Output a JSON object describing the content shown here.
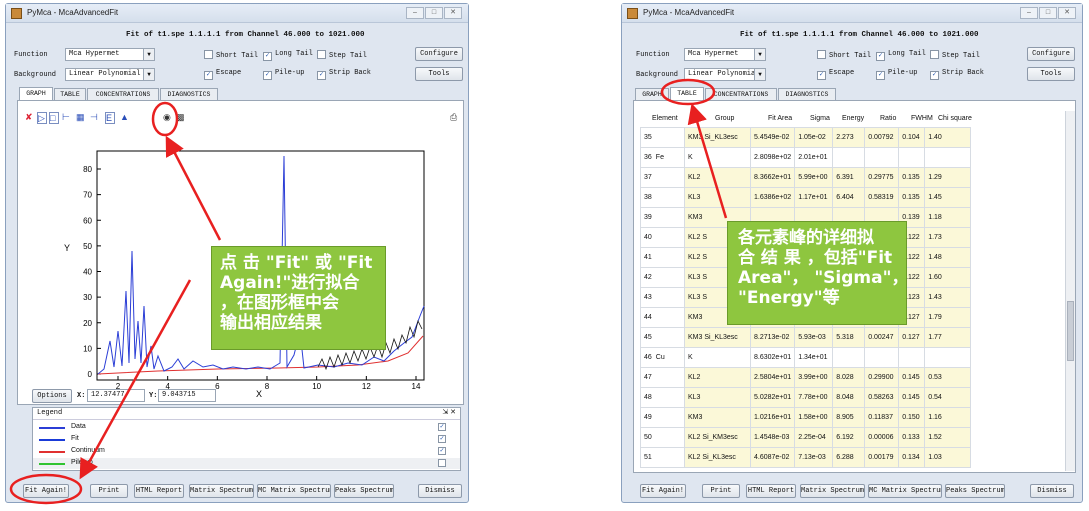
{
  "left_window": {
    "title": "PyMca - McaAdvancedFit",
    "fit_title": "Fit of t1.spe 1.1.1.1 from Channel 46.000 to 1021.000",
    "function_label": "Function",
    "function_value": "Mca Hypermet",
    "background_label": "Background",
    "background_value": "Linear Polynomial",
    "checks": [
      {
        "label": "Short Tail",
        "checked": false
      },
      {
        "label": "Long Tail",
        "checked": true
      },
      {
        "label": "Step Tail",
        "checked": false
      },
      {
        "label": "Escape",
        "checked": true
      },
      {
        "label": "Pile-up",
        "checked": true
      },
      {
        "label": "Strip Back",
        "checked": true
      }
    ],
    "configure_label": "Configure",
    "tools_label": "Tools",
    "tabs": [
      "GRAPH",
      "TABLE",
      "CONCENTRATIONS",
      "DIAGNOSTICS"
    ],
    "plot": {
      "y_label": "Y",
      "x_label": "X",
      "y_ticks": [
        "80",
        "70",
        "60",
        "50",
        "40",
        "30",
        "20",
        "10",
        "0"
      ],
      "x_ticks": [
        "2",
        "4",
        "6",
        "8",
        "10",
        "12",
        "14"
      ]
    },
    "options_label": "Options",
    "x_coord_label": "X:",
    "x_coord_value": "12.37477",
    "y_coord_label": "Y:",
    "y_coord_value": "9.043715",
    "legend_title": "Legend",
    "legend": [
      {
        "name": "Data",
        "color": "#2b3ed6",
        "checked": true
      },
      {
        "name": "Fit",
        "color": "#1a3bd8",
        "checked": true
      },
      {
        "name": "Continuum",
        "color": "#e03030",
        "checked": true
      },
      {
        "name": "Pile-up",
        "color": "#31c431",
        "checked": false
      }
    ],
    "bottom_buttons": [
      "Fit Again!",
      "Print",
      "HTML Report",
      "Matrix Spectrum",
      "MC Matrix Spectrum",
      "Peaks Spectrum",
      "Dismiss"
    ],
    "callout_lines": [
      "点 击 \"Fit\" 或 \"Fit",
      "Again!\"进行拟合",
      "，在图形框中会",
      "输出相应结果"
    ]
  },
  "right_window": {
    "title": "PyMca - McaAdvancedFit",
    "fit_title": "Fit of t1.spe 1.1.1.1 from Channel 46.000 to 1021.000",
    "function_label": "Function",
    "function_value": "Mca Hypermet",
    "background_label": "Background",
    "background_value": "Linear Polynomial",
    "checks": [
      {
        "label": "Short Tail",
        "checked": false
      },
      {
        "label": "Long Tail",
        "checked": true
      },
      {
        "label": "Step Tail",
        "checked": false
      },
      {
        "label": "Escape",
        "checked": true
      },
      {
        "label": "Pile-up",
        "checked": true
      },
      {
        "label": "Strip Back",
        "checked": true
      }
    ],
    "configure_label": "Configure",
    "tools_label": "Tools",
    "tabs": [
      "GRAPH",
      "TABLE",
      "CONCENTRATIONS",
      "DIAGNOSTICS"
    ],
    "table_headers": [
      "Element",
      "Group",
      "Fit Area",
      "Sigma",
      "Energy",
      "Ratio",
      "FWHM",
      "Chi square"
    ],
    "rows": [
      {
        "n": "35",
        "el": "",
        "group": "KM3 Si_KL3esc",
        "area": "5.4549e-02",
        "sigma": "1.05e-02",
        "energy": "2.273",
        "ratio": "0.00792",
        "fwhm": "0.104",
        "chi": "1.40",
        "sh": true
      },
      {
        "n": "36",
        "el": "Fe",
        "group": "K",
        "area": "2.8098e+02",
        "sigma": "2.01e+01",
        "energy": "",
        "ratio": "",
        "fwhm": "",
        "chi": "",
        "sh": false
      },
      {
        "n": "37",
        "el": "",
        "group": "KL2",
        "area": "8.3662e+01",
        "sigma": "5.99e+00",
        "energy": "6.391",
        "ratio": "0.29775",
        "fwhm": "0.135",
        "chi": "1.29",
        "sh": true
      },
      {
        "n": "38",
        "el": "",
        "group": "KL3",
        "area": "1.6386e+02",
        "sigma": "1.17e+01",
        "energy": "6.404",
        "ratio": "0.58319",
        "fwhm": "0.135",
        "chi": "1.45",
        "sh": true
      },
      {
        "n": "39",
        "el": "",
        "group": "KM3",
        "area": "",
        "sigma": "",
        "energy": "",
        "ratio": "",
        "fwhm": "0.139",
        "chi": "1.18",
        "sh": true
      },
      {
        "n": "40",
        "el": "",
        "group": "KL2 S",
        "area": "",
        "sigma": "",
        "energy": "",
        "ratio": "",
        "fwhm": "0.122",
        "chi": "1.73",
        "sh": true
      },
      {
        "n": "41",
        "el": "",
        "group": "KL2 S",
        "area": "",
        "sigma": "",
        "energy": "",
        "ratio": "",
        "fwhm": "0.122",
        "chi": "1.48",
        "sh": true
      },
      {
        "n": "42",
        "el": "",
        "group": "KL3 S",
        "area": "",
        "sigma": "",
        "energy": "",
        "ratio": "",
        "fwhm": "0.122",
        "chi": "1.60",
        "sh": true
      },
      {
        "n": "43",
        "el": "",
        "group": "KL3 S",
        "area": "",
        "sigma": "",
        "energy": "",
        "ratio": "",
        "fwhm": "0.123",
        "chi": "1.43",
        "sh": true
      },
      {
        "n": "44",
        "el": "",
        "group": "KM3",
        "area": "",
        "sigma": "",
        "energy": "",
        "ratio": "",
        "fwhm": "0.127",
        "chi": "1.79",
        "sh": true
      },
      {
        "n": "45",
        "el": "",
        "group": "KM3 Si_KL3esc",
        "area": "8.2713e-02",
        "sigma": "5.93e-03",
        "energy": "5.318",
        "ratio": "0.00247",
        "fwhm": "0.127",
        "chi": "1.77",
        "sh": true
      },
      {
        "n": "46",
        "el": "Cu",
        "group": "K",
        "area": "8.6302e+01",
        "sigma": "1.34e+01",
        "energy": "",
        "ratio": "",
        "fwhm": "",
        "chi": "",
        "sh": false
      },
      {
        "n": "47",
        "el": "",
        "group": "KL2",
        "area": "2.5804e+01",
        "sigma": "3.99e+00",
        "energy": "8.028",
        "ratio": "0.29900",
        "fwhm": "0.145",
        "chi": "0.53",
        "sh": true
      },
      {
        "n": "48",
        "el": "",
        "group": "KL3",
        "area": "5.0282e+01",
        "sigma": "7.78e+00",
        "energy": "8.048",
        "ratio": "0.58263",
        "fwhm": "0.145",
        "chi": "0.54",
        "sh": true
      },
      {
        "n": "49",
        "el": "",
        "group": "KM3",
        "area": "1.0216e+01",
        "sigma": "1.58e+00",
        "energy": "8.905",
        "ratio": "0.11837",
        "fwhm": "0.150",
        "chi": "1.16",
        "sh": true
      },
      {
        "n": "50",
        "el": "",
        "group": "KL2 Si_KM3esc",
        "area": "1.4548e-03",
        "sigma": "2.25e-04",
        "energy": "6.192",
        "ratio": "0.00006",
        "fwhm": "0.133",
        "chi": "1.52",
        "sh": true
      },
      {
        "n": "51",
        "el": "",
        "group": "KL2 Si_KL3esc",
        "area": "4.6087e-02",
        "sigma": "7.13e-03",
        "energy": "6.288",
        "ratio": "0.00179",
        "fwhm": "0.134",
        "chi": "1.03",
        "sh": true
      }
    ],
    "bottom_buttons": [
      "Fit Again!",
      "Print",
      "HTML Report",
      "Matrix Spectrum",
      "MC Matrix Spectrum",
      "Peaks Spectrum",
      "Dismiss"
    ],
    "callout_lines": [
      "各元素峰的详细拟",
      "合 结 果 ，包括\"Fit",
      "Area\"， \"Sigma\"，",
      "\"Energy\"等"
    ]
  }
}
